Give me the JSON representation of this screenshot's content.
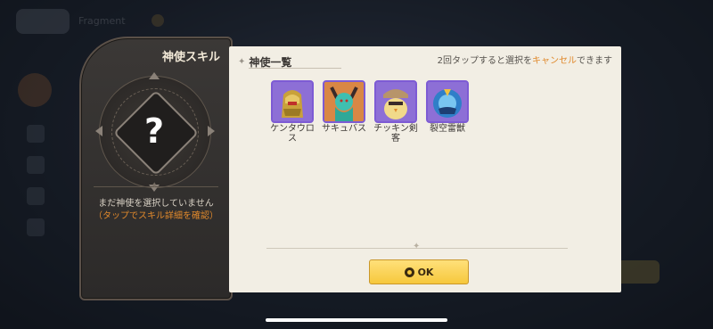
{
  "background": {
    "top_label": "Fragment"
  },
  "skill_panel": {
    "title": "神使スキル",
    "emblem_mark": "?",
    "no_selection_text": "まだ神使を選択していません",
    "tap_hint_text": "（タップでスキル詳細を確認）"
  },
  "select_panel": {
    "list_title": "神使一覧",
    "cancel_hint_prefix": "2回タップすると選択を",
    "cancel_hint_highlight": "キャンセル",
    "cancel_hint_suffix": "できます",
    "items": [
      {
        "name": "ケンタウロス",
        "icon": "centaur-gold-portrait"
      },
      {
        "name": "サキュバス",
        "icon": "succubus-teal-portrait"
      },
      {
        "name": "チッキン剣客",
        "icon": "chicken-swordsman-portrait"
      },
      {
        "name": "裂空雷獣",
        "icon": "thunder-beast-blue-portrait"
      }
    ],
    "ok_label": "OK"
  },
  "colors": {
    "accent_orange": "#e0892c",
    "item_border_purple": "#7d5bd4",
    "ok_yellow": "#f6c83c"
  }
}
